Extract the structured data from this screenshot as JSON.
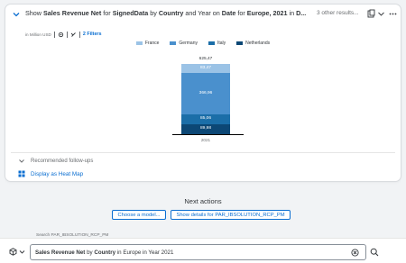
{
  "card": {
    "title_parts": [
      {
        "text": "Show ",
        "bold": false
      },
      {
        "text": "Sales Revenue Net",
        "bold": true
      },
      {
        "text": " for ",
        "bold": false
      },
      {
        "text": "SignedData",
        "bold": true
      },
      {
        "text": " by ",
        "bold": false
      },
      {
        "text": "Country",
        "bold": true
      },
      {
        "text": " and Year on ",
        "bold": false
      },
      {
        "text": "Date",
        "bold": true
      },
      {
        "text": " for ",
        "bold": false
      },
      {
        "text": "Europe, 2021",
        "bold": true
      },
      {
        "text": " in ",
        "bold": false
      },
      {
        "text": "D...",
        "bold": true
      }
    ],
    "more_results": "3 other results...",
    "unit": "in Million USD",
    "filters_label": "2 Filters",
    "icons": [
      "chevron-down-icon",
      "save-icon",
      "dropdown-icon",
      "more-icon",
      "settings-icon",
      "link-icon"
    ]
  },
  "chart_data": {
    "type": "bar",
    "stacked": true,
    "categories": [
      "2021"
    ],
    "series": [
      {
        "name": "France",
        "values": [
          83.47
        ],
        "color": "#9bc3e6"
      },
      {
        "name": "Germany",
        "values": [
          366.96
        ],
        "color": "#4a90cd"
      },
      {
        "name": "Italy",
        "values": [
          85.06
        ],
        "color": "#1b6ea8"
      },
      {
        "name": "Netherlands",
        "values": [
          89.98
        ],
        "color": "#0c4775"
      }
    ],
    "total_label": "625,47",
    "segment_labels": [
      "89,98",
      "85,06",
      "366,96",
      "83,47"
    ],
    "legend_position": "top",
    "grid": false
  },
  "followups_label": "Recommended follow-ups",
  "heatmap_label": "Display as Heat Map",
  "next_actions": {
    "title": "Next actions",
    "buttons": [
      "Choose a model...",
      "Show details for PAR_IBSOLUTION_RCP_PM"
    ]
  },
  "search": {
    "hint": "Search PAR_IBSOLUTION_RCP_PM",
    "query_parts": [
      {
        "text": "Sales Revenue Net",
        "bold": true
      },
      {
        "text": " by ",
        "bold": false
      },
      {
        "text": "Country",
        "bold": true
      },
      {
        "text": " in Europe in Year 2021",
        "bold": false
      }
    ]
  }
}
